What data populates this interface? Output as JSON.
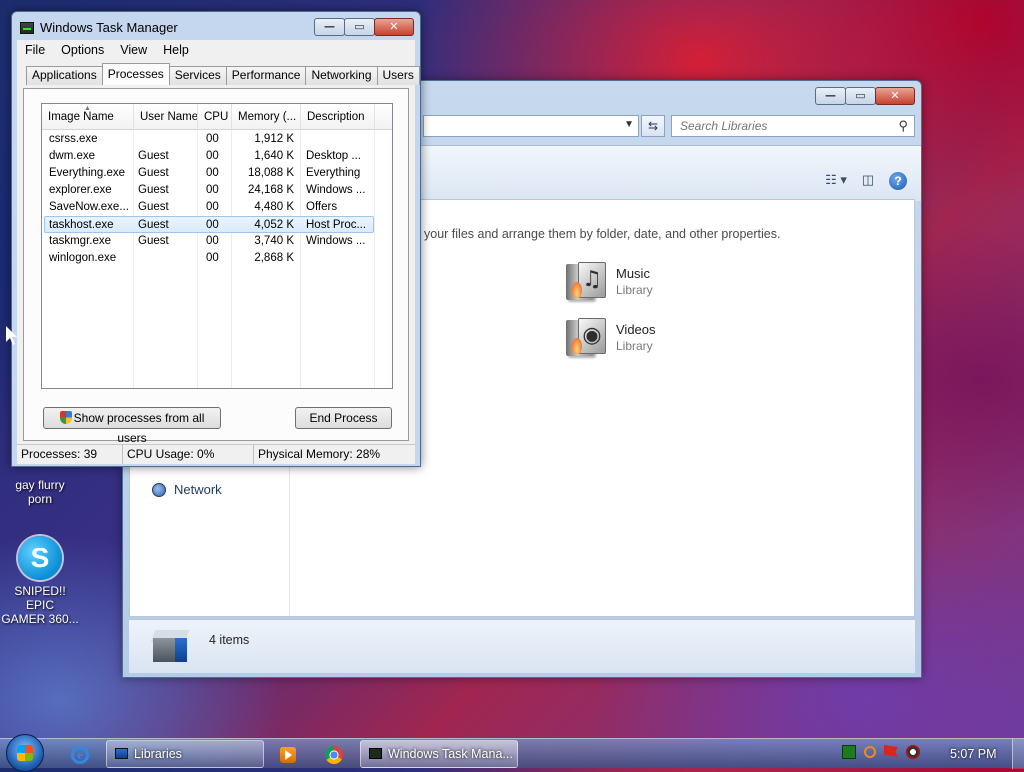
{
  "desktop": {
    "icons": [
      {
        "label_line1": "gay flurry",
        "label_line2": "porn"
      },
      {
        "label_line1": "SNIPED!! EPIC",
        "label_line2": "GAMER 360..."
      }
    ]
  },
  "explorer": {
    "search_placeholder": "Search Libraries",
    "description": "your files and arrange them by folder, date, and other properties.",
    "libraries": [
      {
        "name": "Music",
        "type": "Library"
      },
      {
        "name": "Videos",
        "type": "Library"
      }
    ],
    "nav_network": "Network",
    "items_count": "4 items"
  },
  "taskmgr": {
    "title": "Windows Task Manager",
    "menu": [
      "File",
      "Options",
      "View",
      "Help"
    ],
    "tabs": [
      "Applications",
      "Processes",
      "Services",
      "Performance",
      "Networking",
      "Users"
    ],
    "active_tab": "Processes",
    "columns": [
      "Image Name",
      "User Name",
      "CPU",
      "Memory (...",
      "Description"
    ],
    "processes": [
      {
        "image": "csrss.exe",
        "user": "",
        "cpu": "00",
        "mem": "1,912 K",
        "desc": ""
      },
      {
        "image": "dwm.exe",
        "user": "Guest",
        "cpu": "00",
        "mem": "1,640 K",
        "desc": "Desktop ..."
      },
      {
        "image": "Everything.exe",
        "user": "Guest",
        "cpu": "00",
        "mem": "18,088 K",
        "desc": "Everything"
      },
      {
        "image": "explorer.exe",
        "user": "Guest",
        "cpu": "00",
        "mem": "24,168 K",
        "desc": "Windows ..."
      },
      {
        "image": "SaveNow.exe...",
        "user": "Guest",
        "cpu": "00",
        "mem": "4,480 K",
        "desc": "Offers"
      },
      {
        "image": "taskhost.exe",
        "user": "Guest",
        "cpu": "00",
        "mem": "4,052 K",
        "desc": "Host Proc..."
      },
      {
        "image": "taskmgr.exe",
        "user": "Guest",
        "cpu": "00",
        "mem": "3,740 K",
        "desc": "Windows ..."
      },
      {
        "image": "winlogon.exe",
        "user": "",
        "cpu": "00",
        "mem": "2,868 K",
        "desc": ""
      }
    ],
    "selected_process": "taskhost.exe",
    "show_all_button": "Show processes from all users",
    "end_process_button": "End Process",
    "status": {
      "processes": "Processes: 39",
      "cpu": "CPU Usage: 0%",
      "memory": "Physical Memory: 28%"
    }
  },
  "taskbar": {
    "tasks": [
      {
        "label": "Libraries"
      },
      {
        "label": "Windows Task Mana..."
      }
    ],
    "clock": "5:07 PM"
  },
  "icons": {
    "start": "windows-start-icon",
    "ie": "internet-explorer-icon",
    "media": "media-player-icon",
    "chrome": "chrome-icon"
  }
}
